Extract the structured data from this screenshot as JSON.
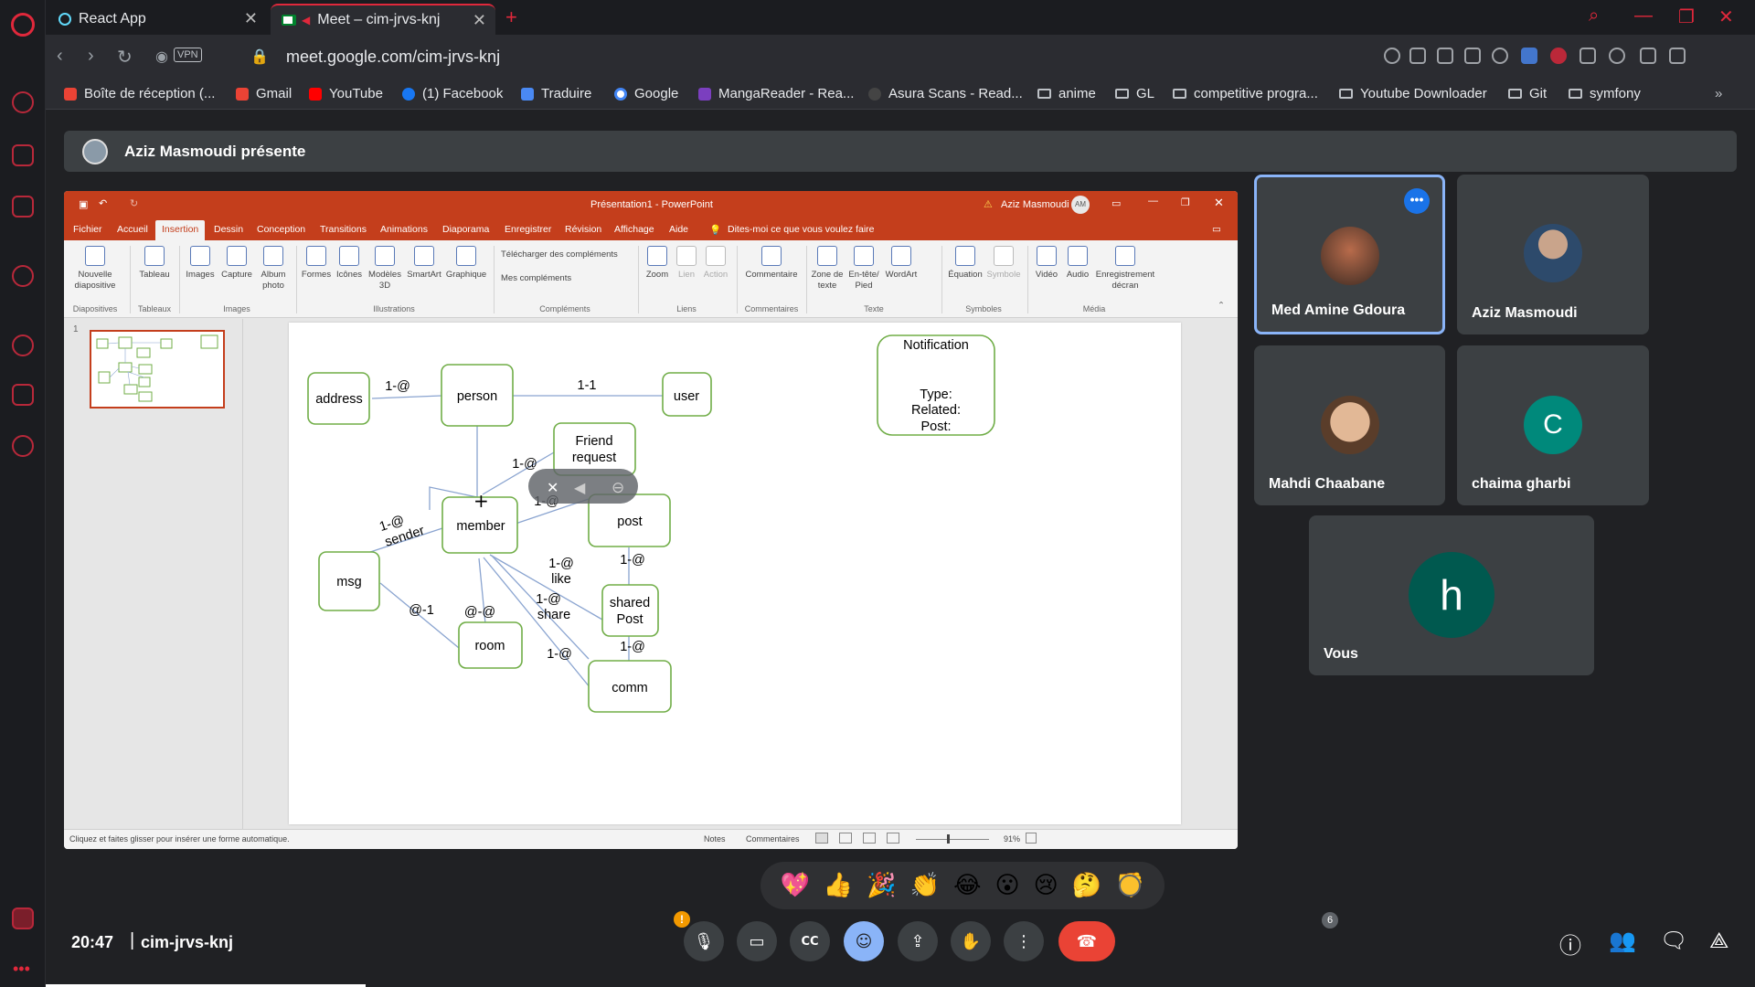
{
  "browser": {
    "tabs": [
      {
        "title": "React App"
      },
      {
        "title": "Meet – cim-jrvs-knj"
      }
    ],
    "url": "meet.google.com/cim-jrvs-knj",
    "vpn_label": "VPN",
    "bookmarks": [
      "Boîte de réception (...",
      "Gmail",
      "YouTube",
      "(1) Facebook",
      "Traduire",
      "Google",
      "MangaReader - Rea...",
      "Asura Scans - Read...",
      "anime",
      "GL",
      "competitive progra...",
      "Youtube Downloader",
      "Git",
      "symfony"
    ],
    "accent_color": "#e0283b"
  },
  "meet": {
    "presenter_banner": "Aziz Masmoudi présente",
    "time": "20:47",
    "meeting_code": "cim-jrvs-knj",
    "participant_count": "6",
    "camera_badge": "!",
    "participants": [
      {
        "name": "Med Amine Gdoura"
      },
      {
        "name": "Aziz Masmoudi"
      },
      {
        "name": "Mahdi Chaabane"
      },
      {
        "name": "chaima gharbi",
        "initial": "C",
        "color": "#00897b"
      },
      {
        "name": "Vous",
        "initial": "h",
        "color": "#00594f"
      }
    ],
    "reactions": [
      "💖",
      "👍",
      "🎉",
      "👏",
      "😂",
      "😮",
      "😢",
      "🤔",
      "👎"
    ],
    "controls": [
      "microphone",
      "camera",
      "captions",
      "emoji",
      "present",
      "raise-hand",
      "more",
      "leave"
    ]
  },
  "powerpoint": {
    "window_title": "Présentation1  -  PowerPoint",
    "user": "Aziz Masmoudi",
    "user_initials": "AM",
    "tabs": [
      "Fichier",
      "Accueil",
      "Insertion",
      "Dessin",
      "Conception",
      "Transitions",
      "Animations",
      "Diaporama",
      "Enregistrer",
      "Révision",
      "Affichage",
      "Aide"
    ],
    "selected_tab": "Insertion",
    "tell_me": "Dites-moi ce que vous voulez faire",
    "ribbon_buttons": [
      "Nouvelle diapositive",
      "Tableau",
      "Images",
      "Capture",
      "Album photo",
      "Formes",
      "Icônes",
      "Modèles 3D",
      "SmartArt",
      "Graphique",
      "Télécharger des compléments",
      "Mes compléments",
      "Zoom",
      "Lien",
      "Action",
      "Commentaire",
      "Zone de texte",
      "En-tête/ Pied",
      "WordArt",
      "Équation",
      "Symbole",
      "Vidéo",
      "Audio",
      "Enregistrement décran"
    ],
    "groups": [
      "Diapositives",
      "Tableaux",
      "Images",
      "Illustrations",
      "Compléments",
      "Liens",
      "Commentaires",
      "Texte",
      "Symboles",
      "Média"
    ],
    "slide_number": "1",
    "status_hint": "Cliquez et faites glisser pour insérer une forme automatique.",
    "status_notes": "Notes",
    "status_comments": "Commentaires",
    "zoom": "91%"
  },
  "diagram": {
    "boxes": {
      "address": "address",
      "person": "person",
      "user": "user",
      "friend_request_1": "Friend",
      "friend_request_2": "request",
      "member": "member",
      "post": "post",
      "msg": "msg",
      "shared_post_1": "shared",
      "shared_post_2": "Post",
      "room": "room",
      "comm": "comm",
      "notification_title": "Notification",
      "notification_type": "Type:",
      "notification_related": "Related:",
      "notification_post": "Post:"
    },
    "edge_labels": {
      "address_person": "1-@",
      "person_user": "1-1",
      "member_friend": "1-@",
      "member_post": "1-@",
      "msg_member_card": "1-@",
      "msg_member_role": "sender",
      "member_like_card": "1-@",
      "member_like_role": "like",
      "member_share_card": "1-@",
      "member_share_role": "share",
      "post_shared": "1-@",
      "msg_room": "@-1",
      "member_room": "@-@",
      "shared_comm": "1-@",
      "member_comm": "1-@"
    },
    "box_color": "#70ad47"
  }
}
